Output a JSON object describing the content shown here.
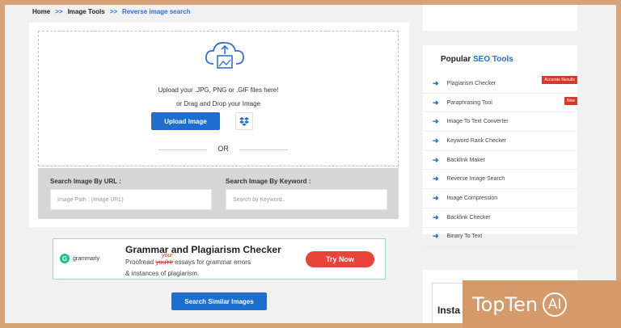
{
  "breadcrumb": {
    "home": "Home",
    "sep": ">>",
    "tools": "Image Tools",
    "current": "Reverse image search"
  },
  "upload": {
    "line1": "Upload your .JPG, PNG or .GIF files here!",
    "line2": "or Drag and Drop your Image",
    "button": "Upload Image",
    "or": "OR",
    "icons": {
      "cloud": "cloud-upload-icon",
      "dropbox": "dropbox-icon"
    }
  },
  "search": {
    "url_label": "Search Image By URL :",
    "url_placeholder": "Image Path : (Image URL)",
    "kw_label": "Search Image By Keyword :",
    "kw_placeholder": "Search by Keyword.."
  },
  "ad": {
    "brand": "grammarly",
    "title": "Grammar and Plagiarism Checker",
    "line1_pre": "Proofread",
    "line1_struck": "you're",
    "line1_insert": "your",
    "line1_post": "essays for grammar errors",
    "line2": "& instances of plagiarism.",
    "cta": "Try Now"
  },
  "similar_button": "Search Similar Images",
  "sidebar": {
    "title_pre": "Popular",
    "title_accent": "SEO Tools",
    "items": [
      {
        "label": "Plagiarism Checker",
        "badge": "Accurate Results"
      },
      {
        "label": "Paraphrasing Tool",
        "badge": "New"
      },
      {
        "label": "Image To Text Converter"
      },
      {
        "label": "Keyword Rank Checker"
      },
      {
        "label": "Backlink Maker"
      },
      {
        "label": "Reverse Image Search"
      },
      {
        "label": "Image Compression"
      },
      {
        "label": "Backlink Checker"
      },
      {
        "label": "Binary To Text"
      }
    ],
    "bottom_partial": "Insta"
  },
  "watermark": {
    "text": "TopTen",
    "circle": "AI"
  },
  "colors": {
    "primary": "#1c6fcf",
    "badge": "#d63a2e",
    "cta": "#e8443a",
    "frame": "#d6a477"
  }
}
